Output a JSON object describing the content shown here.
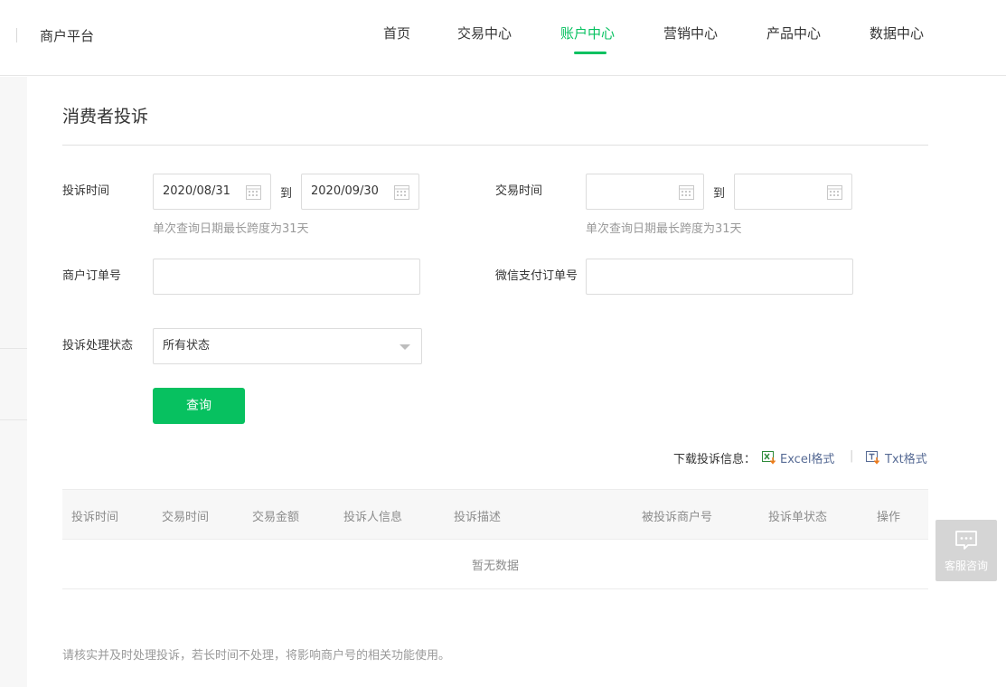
{
  "header": {
    "brand": "商户平台",
    "nav": [
      "首页",
      "交易中心",
      "账户中心",
      "营销中心",
      "产品中心",
      "数据中心"
    ],
    "active_nav": "账户中心"
  },
  "page": {
    "title": "消费者投诉"
  },
  "form": {
    "complaint_time_label": "投诉时间",
    "complaint_start": "2020/08/31",
    "complaint_end": "2020/09/30",
    "to_label": "到",
    "range_hint": "单次查询日期最长跨度为31天",
    "trade_time_label": "交易时间",
    "trade_start": "",
    "trade_end": "",
    "merchant_order_label": "商户订单号",
    "merchant_order_value": "",
    "wechat_order_label": "微信支付订单号",
    "wechat_order_value": "",
    "status_label": "投诉处理状态",
    "status_selected": "所有状态",
    "query_button": "查询"
  },
  "download": {
    "label": "下载投诉信息：",
    "excel": "Excel格式",
    "separator": "|",
    "txt": "Txt格式"
  },
  "table": {
    "columns": [
      "投诉时间",
      "交易时间",
      "交易金额",
      "投诉人信息",
      "投诉描述",
      "被投诉商户号",
      "投诉单状态",
      "操作"
    ],
    "empty_text": "暂无数据"
  },
  "footnote": "请核实并及时处理投诉，若长时间不处理，将影响商户号的相关功能使用。",
  "support": {
    "label": "客服咨询",
    "icon": "chat-bubble-icon"
  },
  "colors": {
    "accent": "#07c160",
    "link": "#576b95"
  }
}
